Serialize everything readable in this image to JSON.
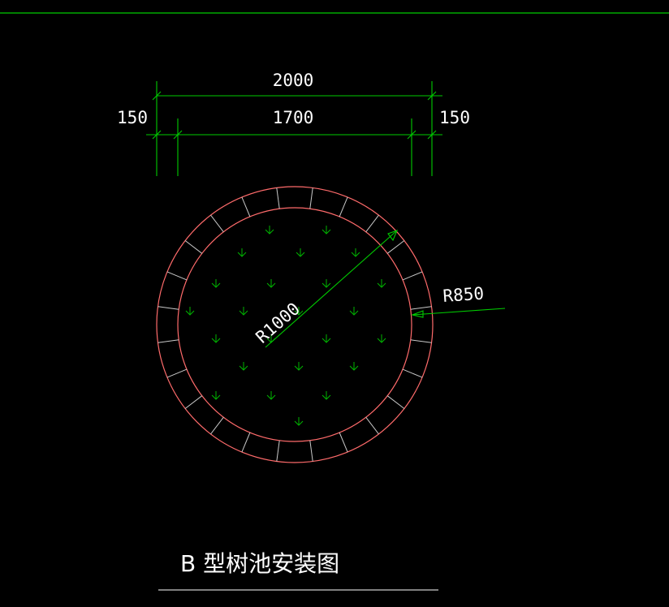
{
  "drawing": {
    "background": "#000000",
    "colors": {
      "dimension_line": "#00cc00",
      "pit_outline": "#ff6b6b",
      "segment_joint": "#c8c8c8",
      "plant_symbol": "#00b400",
      "text": "#ffffff"
    },
    "dimensions": {
      "overall": "2000",
      "inner": "1700",
      "left_border": "150",
      "right_border": "150"
    },
    "radius_labels": {
      "outer": "R1000",
      "inner": "R850"
    },
    "title": "B 型树池安装图",
    "plant_symbol": "arrow-down-icon"
  }
}
